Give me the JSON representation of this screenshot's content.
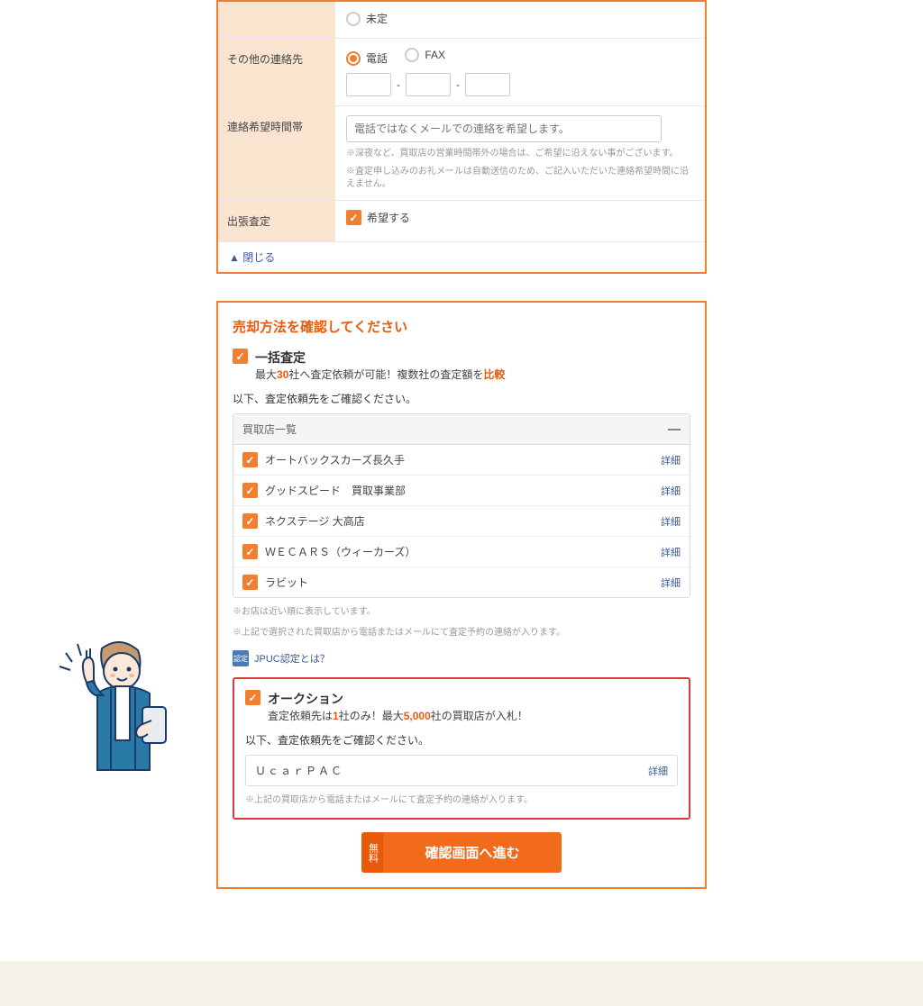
{
  "form": {
    "option_undecided": "未定",
    "other_contact_label": "その他の連絡先",
    "radio_phone": "電話",
    "radio_fax": "FAX",
    "time_label": "連絡希望時間帯",
    "time_placeholder": "電話ではなくメールでの連絡を希望します。",
    "time_note1": "※深夜など、買取店の営業時間帯外の場合は、ご希望に沿えない事がございます。",
    "time_note2": "※査定申し込みのお礼メールは自動送信のため、ご記入いただいた連絡希望時間に沿えません。",
    "visit_label": "出張査定",
    "visit_check": "希望する",
    "collapse": "▲ 閉じる"
  },
  "sale": {
    "heading": "売却方法を確認してください",
    "ikkatsu_title": "一括査定",
    "ikkatsu_desc_pre": "最大",
    "ikkatsu_desc_num": "30",
    "ikkatsu_desc_mid": "社へ査定依頼が可能！複数社の査定額を",
    "ikkatsu_desc_post": "比較",
    "confirm_note": "以下、査定依頼先をご確認ください。",
    "store_list_header": "買取店一覧",
    "stores": [
      {
        "name": "オートバックスカーズ長久手",
        "detail": "詳細"
      },
      {
        "name": "グッドスピード　買取事業部",
        "detail": "詳細"
      },
      {
        "name": "ネクステージ 大高店",
        "detail": "詳細"
      },
      {
        "name": "ＷＥＣＡＲＳ（ウィーカーズ）",
        "detail": "詳細"
      },
      {
        "name": "ラビット",
        "detail": "詳細"
      }
    ],
    "store_note1": "※お店は近い順に表示しています。",
    "store_note2": "※上記で選択された買取店から電話またはメールにて査定予約の連絡が入ります。",
    "jpuc_badge": "認定",
    "jpuc_link": "JPUC認定とは？",
    "auction_title": "オークション",
    "auction_desc_pre": "査定依頼先は",
    "auction_desc_one": "1",
    "auction_desc_mid": "社のみ！最大",
    "auction_desc_num": "5,000",
    "auction_desc_post": "社の買取店が入札！",
    "auction_store_name": "ＵｃａｒＰＡＣ",
    "auction_detail": "詳細",
    "auction_note": "※上記の買取店から電話またはメールにて査定予約の連絡が入ります。",
    "submit_tag": "無料",
    "submit_label": "確認画面へ進む"
  }
}
